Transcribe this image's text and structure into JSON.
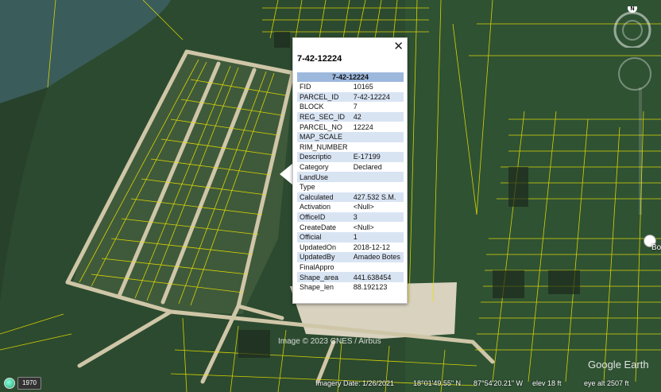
{
  "popup": {
    "title": "7-42-12224",
    "table_header": "7-42-12224",
    "close_glyph": "✕",
    "rows": [
      {
        "k": "FID",
        "v": "10165"
      },
      {
        "k": "PARCEL_ID",
        "v": "7-42-12224"
      },
      {
        "k": "BLOCK",
        "v": "7"
      },
      {
        "k": "REG_SEC_ID",
        "v": "42"
      },
      {
        "k": "PARCEL_NO",
        "v": "12224"
      },
      {
        "k": "MAP_SCALE",
        "v": ""
      },
      {
        "k": "RIM_NUMBER",
        "v": ""
      },
      {
        "k": "Descriptio",
        "v": "E-17199"
      },
      {
        "k": "Category",
        "v": "Declared"
      },
      {
        "k": "LandUse",
        "v": ""
      },
      {
        "k": "Type",
        "v": ""
      },
      {
        "k": "Calculated",
        "v": "427.532 S.M."
      },
      {
        "k": "Activation",
        "v": "<Null>"
      },
      {
        "k": "OfficeID",
        "v": "3"
      },
      {
        "k": "CreateDate",
        "v": "<Null>"
      },
      {
        "k": "Official",
        "v": "1"
      },
      {
        "k": "UpdatedOn",
        "v": "2018-12-12"
      },
      {
        "k": "UpdatedBy",
        "v": "Amadeo Botes"
      },
      {
        "k": "FinalAppro",
        "v": ""
      },
      {
        "k": "Shape_area",
        "v": "441.638454"
      },
      {
        "k": "Shape_len",
        "v": "88.192123"
      }
    ]
  },
  "status": {
    "year": "1970",
    "imagery_date": "Imagery Date: 1/26/2021",
    "lat": "18°01'49.55\" N",
    "lon": "87°54'20.21\" W",
    "elev": "elev   18 ft",
    "eye_alt": "eye alt  2507 ft",
    "watermark": "Image © 2023 CNES / Airbus",
    "logo": "Google Earth",
    "compass_north": "N",
    "edge_label": "Bo"
  },
  "colors": {
    "parcel_lines": "#e8e000",
    "road": "#cfc6a8",
    "forest": "#2d4a2e"
  }
}
